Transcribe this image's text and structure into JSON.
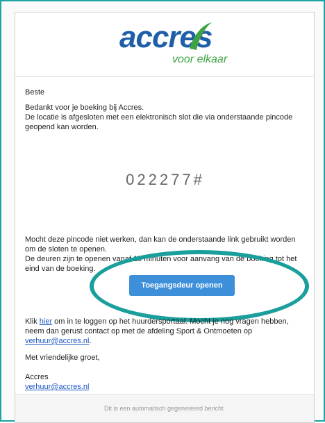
{
  "logo": {
    "brand_name": "accres",
    "tagline": "voor elkaar",
    "colors": {
      "blue": "#1f5ea8",
      "green": "#3ea343"
    }
  },
  "email": {
    "greeting": "Beste",
    "intro_line1": "Bedankt voor je boeking bij Accres.",
    "intro_line2": "De locatie is afgesloten met een elektronisch slot die via onderstaande pincode geopend kan worden.",
    "pincode": "022277#",
    "info_line1": "Mocht deze pincode niet werken, dan kan de onderstaande link gebruikt worden om de sloten te openen.",
    "info_line2": "De deuren zijn te openen vanaf 15 minuten voor aanvang van de boeking tot het eind van de boeking.",
    "button_label": "Toegangsdeur openen",
    "portal_prefix": "Klik ",
    "portal_link": "hier",
    "portal_text": " om in te loggen op het huurdersportaal. Mocht je nog vragen hebben, neem dan gerust contact op met de afdeling Sport & Ontmoeten op ",
    "contact_email": "verhuur@accres.nl",
    "portal_suffix": ".",
    "closing": "Met vriendelijke groet,",
    "signature_name": "Accres",
    "signature_email": "verhuur@accres.nl",
    "footer": "Dit is een automatisch gegenereerd bericht."
  },
  "colors": {
    "frame_border": "#1aa5a4",
    "button_bg": "#3d8fd9",
    "highlight_ring": "#1a9f9c",
    "link": "#1a55c4"
  }
}
